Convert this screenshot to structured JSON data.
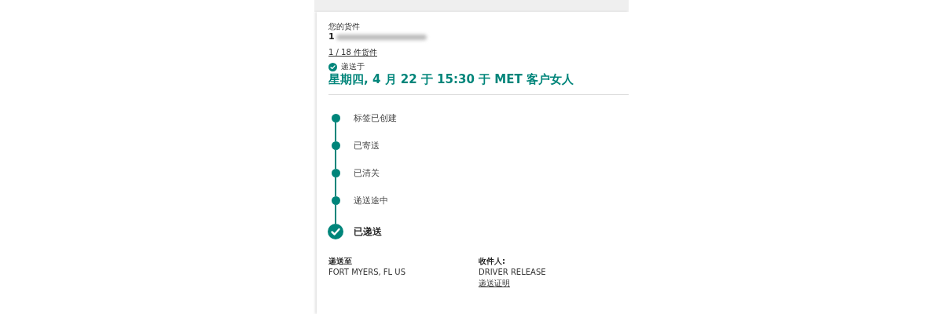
{
  "shipment": {
    "label": "您的货件",
    "tracking_number_visible": "1",
    "count_link": "1 / 18 件货件"
  },
  "status": {
    "label": "递送于",
    "headline": "星期四, 4 月 22 于 15:30 于 MET 客户女人"
  },
  "steps": [
    {
      "kind": "step",
      "label": "标签已创建"
    },
    {
      "kind": "step",
      "label": "已寄送"
    },
    {
      "kind": "step",
      "label": "已清关"
    },
    {
      "kind": "step",
      "label": "递送途中"
    },
    {
      "kind": "final",
      "label": "已递送"
    }
  ],
  "details": [
    {
      "heading": "递送至",
      "value": "FORT MYERS, FL US"
    },
    {
      "heading": "收件人:",
      "value": "DRIVER RELEASE",
      "link": "递送证明"
    }
  ]
}
